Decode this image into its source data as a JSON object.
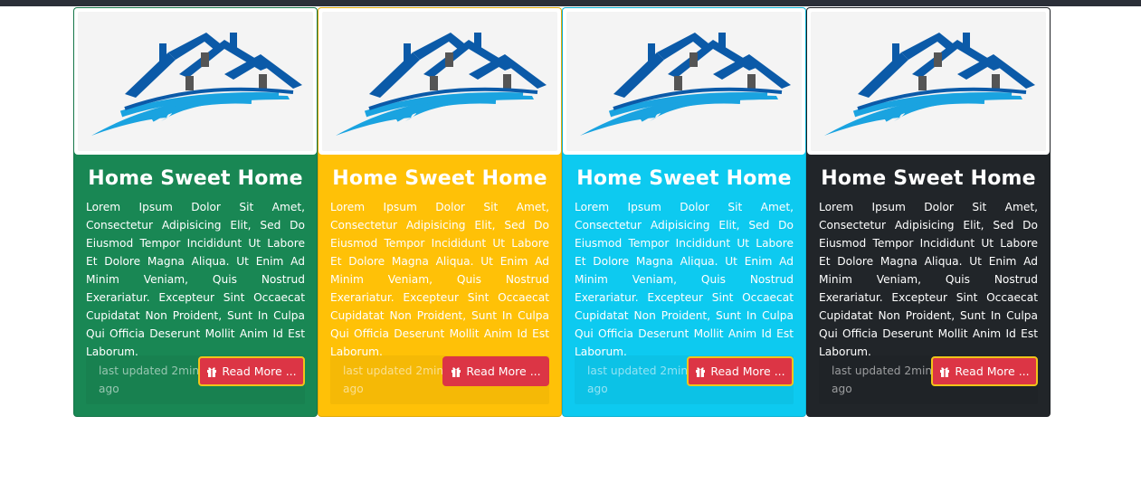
{
  "cards": [
    {
      "title": "Home Sweet Home",
      "text": "Lorem Ipsum Dolor Sit Amet, Consectetur Adipisicing Elit, Sed Do Eiusmod Tempor Incididunt Ut Labore Et Dolore Magna Aliqua. Ut Enim Ad Minim Veniam, Quis Nostrud Exerariatur. Excepteur Sint Occaecat Cupidatat Non Proident, Sunt In Culpa Qui Officia Deserunt Mollit Anim Id Est Laborum.",
      "updated": "last updated 2min ago",
      "button": "Read More ...",
      "bg_color": "#198754",
      "button_icon": "gift-icon"
    },
    {
      "title": "Home Sweet Home",
      "text": "Lorem Ipsum Dolor Sit Amet, Consectetur Adipisicing Elit, Sed Do Eiusmod Tempor Incididunt Ut Labore Et Dolore Magna Aliqua. Ut Enim Ad Minim Veniam, Quis Nostrud Exerariatur. Excepteur Sint Occaecat Cupidatat Non Proident, Sunt In Culpa Qui Officia Deserunt Mollit Anim Id Est Laborum.",
      "updated": "last updated 2min ago",
      "button": "Read More ...",
      "bg_color": "#ffc107",
      "button_icon": "gift-icon"
    },
    {
      "title": "Home Sweet Home",
      "text": "Lorem Ipsum Dolor Sit Amet, Consectetur Adipisicing Elit, Sed Do Eiusmod Tempor Incididunt Ut Labore Et Dolore Magna Aliqua. Ut Enim Ad Minim Veniam, Quis Nostrud Exerariatur. Excepteur Sint Occaecat Cupidatat Non Proident, Sunt In Culpa Qui Officia Deserunt Mollit Anim Id Est Laborum.",
      "updated": "last updated 2min ago",
      "button": "Read More ...",
      "bg_color": "#0dcaf0",
      "button_icon": "gift-icon"
    },
    {
      "title": "Home Sweet Home",
      "text": "Lorem Ipsum Dolor Sit Amet, Consectetur Adipisicing Elit, Sed Do Eiusmod Tempor Incididunt Ut Labore Et Dolore Magna Aliqua. Ut Enim Ad Minim Veniam, Quis Nostrud Exerariatur. Excepteur Sint Occaecat Cupidatat Non Proident, Sunt In Culpa Qui Officia Deserunt Mollit Anim Id Est Laborum.",
      "updated": "last updated 2min ago",
      "button": "Read More ...",
      "bg_color": "#212529",
      "button_icon": "gift-icon"
    }
  ],
  "colors": {
    "topbar": "#2b2f38",
    "button": "#dc3545",
    "button_focus_border": "#f0c419",
    "logo_dark_blue": "#0b5aa8",
    "logo_light_blue": "#1aa3e0"
  }
}
